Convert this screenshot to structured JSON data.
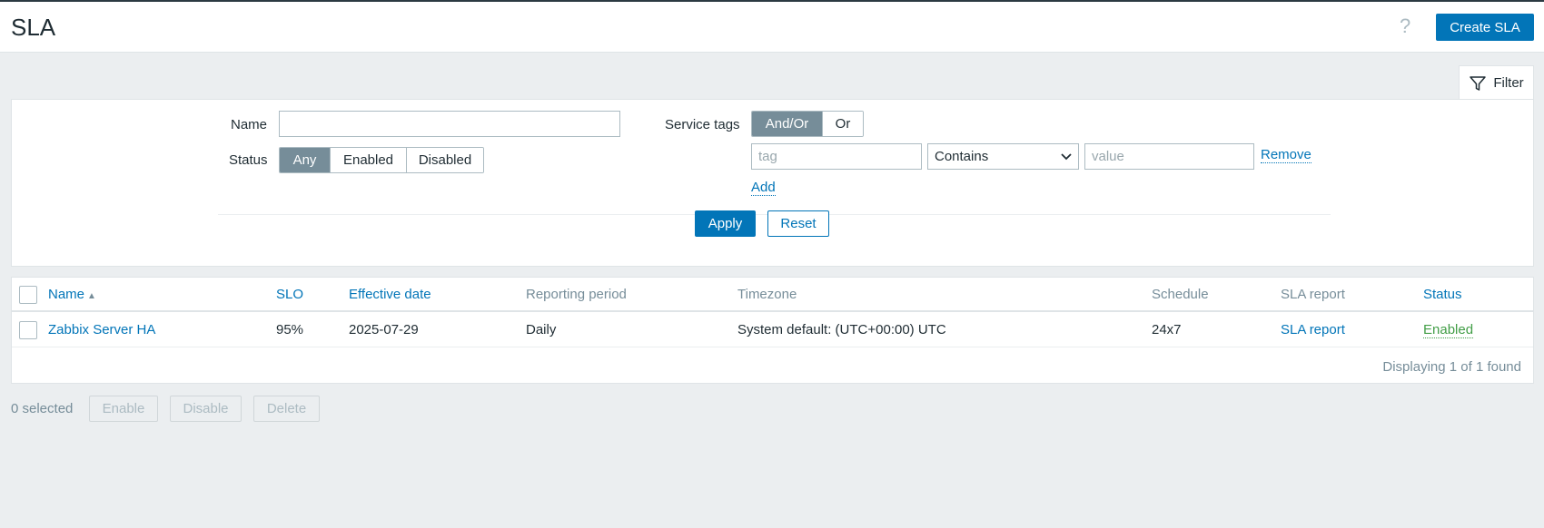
{
  "header": {
    "title": "SLA",
    "help_symbol": "?",
    "create_label": "Create SLA"
  },
  "filter": {
    "tab_label": "Filter",
    "name_label": "Name",
    "name_value": "",
    "status_label": "Status",
    "status_options": [
      "Any",
      "Enabled",
      "Disabled"
    ],
    "status_selected": "Any",
    "service_tags_label": "Service tags",
    "tag_operator_options": [
      "And/Or",
      "Or"
    ],
    "tag_operator_selected": "And/Or",
    "tag_placeholder": "tag",
    "tag_condition": "Contains",
    "value_placeholder": "value",
    "remove_label": "Remove",
    "add_label": "Add",
    "apply_label": "Apply",
    "reset_label": "Reset"
  },
  "table": {
    "columns": [
      "Name",
      "SLO",
      "Effective date",
      "Reporting period",
      "Timezone",
      "Schedule",
      "SLA report",
      "Status"
    ],
    "sort_column": "Name",
    "sort_direction": "ascending",
    "rows": [
      {
        "name": "Zabbix Server HA",
        "slo": "95%",
        "effective_date": "2025-07-29",
        "reporting_period": "Daily",
        "timezone": "System default: (UTC+00:00) UTC",
        "schedule": "24x7",
        "sla_report": "SLA report",
        "status": "Enabled"
      }
    ],
    "footer": "Displaying 1 of 1 found"
  },
  "actions": {
    "selected_count": "0 selected",
    "enable_label": "Enable",
    "disable_label": "Disable",
    "delete_label": "Delete"
  },
  "colors": {
    "accent": "#0275b8",
    "status_enabled": "#429e47",
    "segment_active": "#768d99",
    "background": "#ebeef0"
  }
}
